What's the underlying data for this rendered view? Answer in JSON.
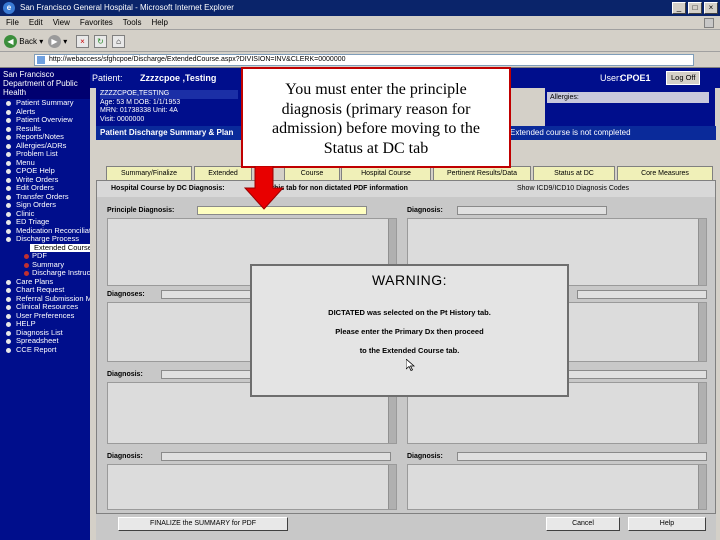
{
  "browser": {
    "title": "San Francisco General Hospital - Microsoft Internet Explorer",
    "menu": [
      "File",
      "Edit",
      "View",
      "Favorites",
      "Tools",
      "Help"
    ],
    "back_label": "Back",
    "address": "http://webaccess/sfghcpoe/Discharge/ExtendedCourse.aspx?DIVISION=INV&CLERK=0000000"
  },
  "sidebar": {
    "header": "San Francisco Department of Public Health",
    "items": [
      {
        "label": "Patient Summary"
      },
      {
        "label": "Alerts"
      },
      {
        "label": "Patient Overview"
      },
      {
        "label": "Results"
      },
      {
        "label": "Reports/Notes"
      },
      {
        "label": "Allergies/ADRs"
      },
      {
        "label": "Problem List"
      },
      {
        "label": "Menu"
      },
      {
        "label": "CPOE Help"
      },
      {
        "label": "Write Orders"
      },
      {
        "label": "Edit Orders"
      },
      {
        "label": "Transfer Orders"
      },
      {
        "label": "Sign Orders"
      },
      {
        "label": "Clinic"
      },
      {
        "label": "ED Triage"
      },
      {
        "label": "Medication Reconciliation"
      },
      {
        "label": "Discharge Process"
      },
      {
        "label": "Extended Course",
        "sub": true,
        "selected": true
      },
      {
        "label": "PDF",
        "sub": true
      },
      {
        "label": "Summary",
        "sub": true
      },
      {
        "label": "Discharge Instructions",
        "sub": true
      },
      {
        "label": "Care Plans"
      },
      {
        "label": "Chart Request"
      },
      {
        "label": "Referral Submission Menu"
      },
      {
        "label": "Clinical Resources"
      },
      {
        "label": "User Preferences"
      },
      {
        "label": "HELP"
      },
      {
        "label": "Diagnosis List"
      },
      {
        "label": "Spreadsheet"
      },
      {
        "label": "CCE Report"
      }
    ]
  },
  "patient": {
    "label": "Patient:",
    "name": "Zzzzcpoe ,Testing",
    "user_label": "User:",
    "user": "CPOE1",
    "logoff": "Log Off",
    "info_name": "ZZZZCPOE,TESTING",
    "info_lines": [
      "Age: 53 M  DOB: 1/1/1953",
      "MRN: 01738338  Unit: 4A",
      "Visit: 0000000"
    ],
    "allergies_label": "Allergies:",
    "section_title": "Patient Discharge Summary & Plan",
    "section_status": "Extended course is not completed"
  },
  "callout": {
    "text_lines": [
      "You must enter the principle",
      "diagnosis (primary reason for",
      "admission) before moving to the",
      "Status at DC tab"
    ]
  },
  "tabs": [
    {
      "label": "Summary/Finalize"
    },
    {
      "label": "Extended"
    },
    {
      "label": "Course"
    },
    {
      "label": "Hospital Course"
    },
    {
      "label": "Pertinent Results/Data"
    },
    {
      "label": "Status at DC"
    },
    {
      "label": "Core Measures"
    }
  ],
  "content": {
    "header_left": "Hospital Course by DC Diagnosis:",
    "header_mid": "Use this tab for non dictated PDF information",
    "header_right": "Show ICD9/ICD10 Diagnosis Codes",
    "principle_label": "Principle Diagnosis:",
    "diagnosis_label": "Diagnosis:",
    "diagnoses_label": "Diagnoses:"
  },
  "warning": {
    "title": "WARNING:",
    "lines": [
      "DICTATED was selected on the Pt History tab.",
      "Please enter the Primary Dx then proceed",
      "to the Extended Course tab."
    ]
  },
  "buttons": {
    "finalize": "FINALIZE the SUMMARY for PDF",
    "cancel": "Cancel",
    "help": "Help"
  }
}
